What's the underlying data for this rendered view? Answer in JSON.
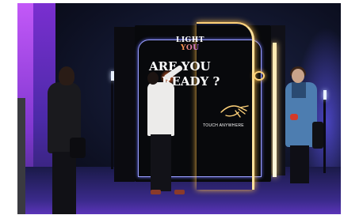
{
  "scene": {
    "logo_light": "LIGHT",
    "logo_you": "YOU",
    "headline_line1": "ARE YOU",
    "headline_line2": "READY ?",
    "cta": "TOUCH ANYWHERE"
  },
  "colors": {
    "neon": "#ffd27a",
    "ambient": "#4c2aa8",
    "screen": "#08090c"
  }
}
